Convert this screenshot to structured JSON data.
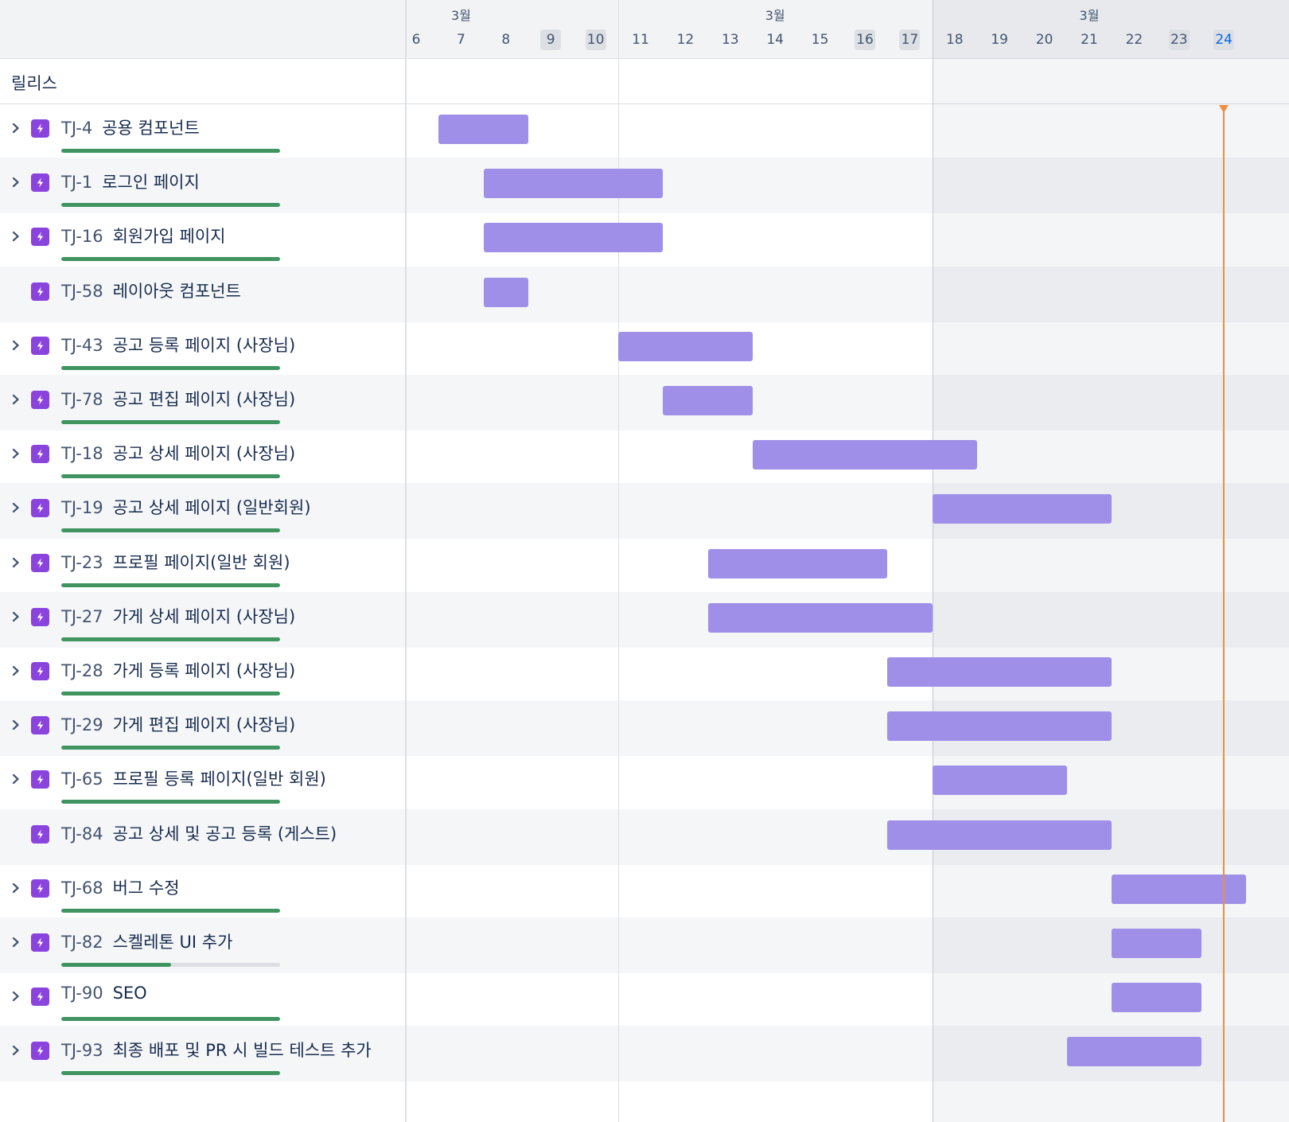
{
  "release_label": "릴리스",
  "month_labels": [
    "3월",
    "3월",
    "3월"
  ],
  "days": [
    {
      "label": "6",
      "weekend": false,
      "today": false
    },
    {
      "label": "7",
      "weekend": false,
      "today": false
    },
    {
      "label": "8",
      "weekend": false,
      "today": false
    },
    {
      "label": "9",
      "weekend": true,
      "today": false
    },
    {
      "label": "10",
      "weekend": true,
      "today": false
    },
    {
      "label": "11",
      "weekend": false,
      "today": false
    },
    {
      "label": "12",
      "weekend": false,
      "today": false
    },
    {
      "label": "13",
      "weekend": false,
      "today": false
    },
    {
      "label": "14",
      "weekend": false,
      "today": false
    },
    {
      "label": "15",
      "weekend": false,
      "today": false
    },
    {
      "label": "16",
      "weekend": true,
      "today": false
    },
    {
      "label": "17",
      "weekend": true,
      "today": false
    },
    {
      "label": "18",
      "weekend": false,
      "today": false
    },
    {
      "label": "19",
      "weekend": false,
      "today": false
    },
    {
      "label": "20",
      "weekend": false,
      "today": false
    },
    {
      "label": "21",
      "weekend": false,
      "today": false
    },
    {
      "label": "22",
      "weekend": false,
      "today": false
    },
    {
      "label": "23",
      "weekend": true,
      "today": false
    },
    {
      "label": "24",
      "weekend": true,
      "today": true
    }
  ],
  "today": "24",
  "colors": {
    "bar": "#9f8fe8",
    "epic_icon": "#8b43de",
    "progress_done": "#3f9460",
    "progress_track": "#dcdfe4",
    "today_line": "#f18d42",
    "today_label": "#0c66e4"
  },
  "issues": [
    {
      "key": "TJ-4",
      "summary": "공용 컴포넌트",
      "expandable": true,
      "progress": 1.0,
      "start": "7",
      "end": "8"
    },
    {
      "key": "TJ-1",
      "summary": "로그인 페이지",
      "expandable": true,
      "progress": 1.0,
      "start": "8",
      "end": "11"
    },
    {
      "key": "TJ-16",
      "summary": "회원가입 페이지",
      "expandable": true,
      "progress": 1.0,
      "start": "8",
      "end": "11"
    },
    {
      "key": "TJ-58",
      "summary": "레이아웃 컴포넌트",
      "expandable": false,
      "progress": null,
      "start": "8",
      "end": "8"
    },
    {
      "key": "TJ-43",
      "summary": "공고 등록 페이지 (사장님)",
      "expandable": true,
      "progress": 1.0,
      "start": "11",
      "end": "13"
    },
    {
      "key": "TJ-78",
      "summary": "공고 편집 페이지 (사장님)",
      "expandable": true,
      "progress": 1.0,
      "start": "12",
      "end": "13"
    },
    {
      "key": "TJ-18",
      "summary": "공고 상세 페이지 (사장님)",
      "expandable": true,
      "progress": 1.0,
      "start": "14",
      "end": "18"
    },
    {
      "key": "TJ-19",
      "summary": "공고 상세 페이지 (일반회원)",
      "expandable": true,
      "progress": 1.0,
      "start": "18",
      "end": "21"
    },
    {
      "key": "TJ-23",
      "summary": "프로필 페이지(일반 회원)",
      "expandable": true,
      "progress": 1.0,
      "start": "13",
      "end": "16"
    },
    {
      "key": "TJ-27",
      "summary": "가게 상세 페이지 (사장님)",
      "expandable": true,
      "progress": 1.0,
      "start": "13",
      "end": "17"
    },
    {
      "key": "TJ-28",
      "summary": "가게 등록 페이지 (사장님)",
      "expandable": true,
      "progress": 1.0,
      "start": "17",
      "end": "21"
    },
    {
      "key": "TJ-29",
      "summary": "가게 편집 페이지 (사장님)",
      "expandable": true,
      "progress": 1.0,
      "start": "17",
      "end": "21"
    },
    {
      "key": "TJ-65",
      "summary": "프로필 등록 페이지(일반 회원)",
      "expandable": true,
      "progress": 1.0,
      "start": "18",
      "end": "20"
    },
    {
      "key": "TJ-84",
      "summary": "공고 상세 및 공고 등록 (게스트)",
      "expandable": false,
      "progress": null,
      "start": "17",
      "end": "21"
    },
    {
      "key": "TJ-68",
      "summary": "버그 수정",
      "expandable": true,
      "progress": 1.0,
      "start": "22",
      "end": "24"
    },
    {
      "key": "TJ-82",
      "summary": "스켈레톤 UI 추가",
      "expandable": true,
      "progress": 0.5,
      "start": "22",
      "end": "23"
    },
    {
      "key": "TJ-90",
      "summary": "SEO",
      "expandable": true,
      "progress": 1.0,
      "start": "22",
      "end": "23"
    },
    {
      "key": "TJ-93",
      "summary": "최종 배포 및 PR 시 빌드 테스트 추가",
      "expandable": true,
      "progress": 1.0,
      "start": "21",
      "end": "23"
    }
  ]
}
